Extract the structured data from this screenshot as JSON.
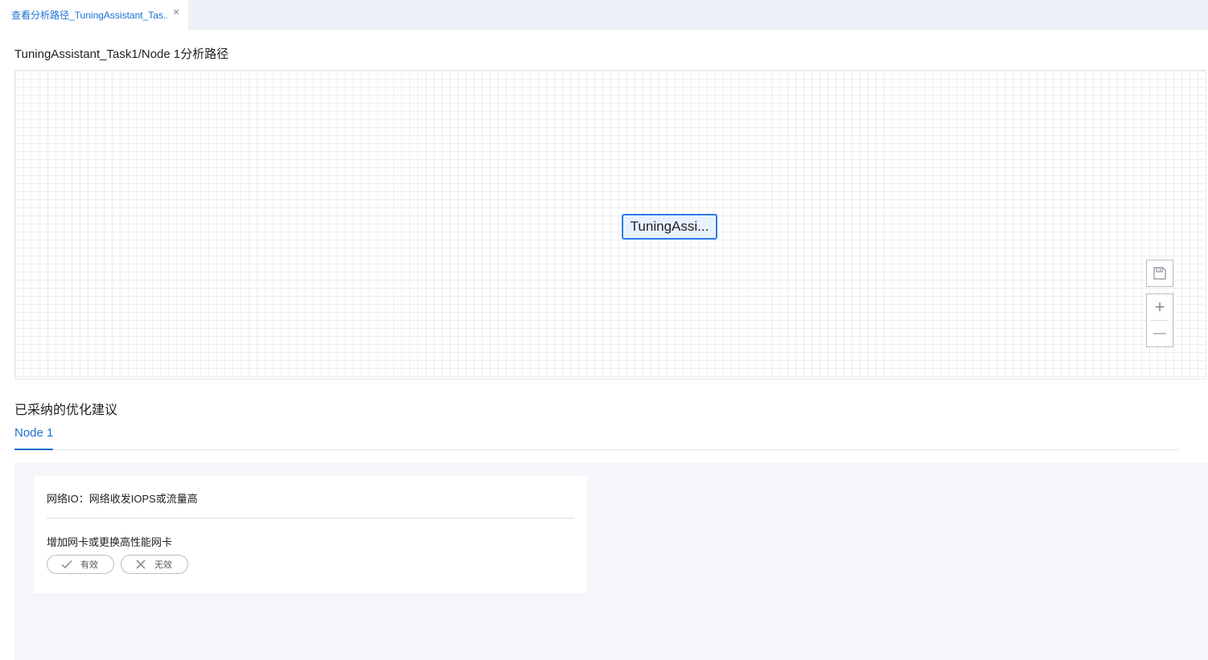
{
  "tab": {
    "label": "查看分析路径_TuningAssistant_Tas...",
    "close_glyph": "×"
  },
  "page_title": "TuningAssistant_Task1/Node 1分析路径",
  "graph": {
    "node_label": "TuningAssi...",
    "tools": {
      "save_icon": "save-icon",
      "zoom_in_glyph": "+",
      "zoom_out_glyph": "—"
    }
  },
  "adopted_section": {
    "title": "已采纳的优化建议",
    "node_tabs": [
      {
        "label": "Node 1",
        "active": true
      }
    ],
    "card": {
      "problem": "网络IO：网络收发IOPS或流量高",
      "suggestion": "增加网卡或更换高性能网卡",
      "valid_label": "有效",
      "invalid_label": "无效"
    }
  },
  "colors": {
    "accent": "#1b6fd1",
    "node_border": "#2f7be5",
    "node_fill": "#e8f1ff",
    "panel_bg": "#f4f6fa"
  }
}
